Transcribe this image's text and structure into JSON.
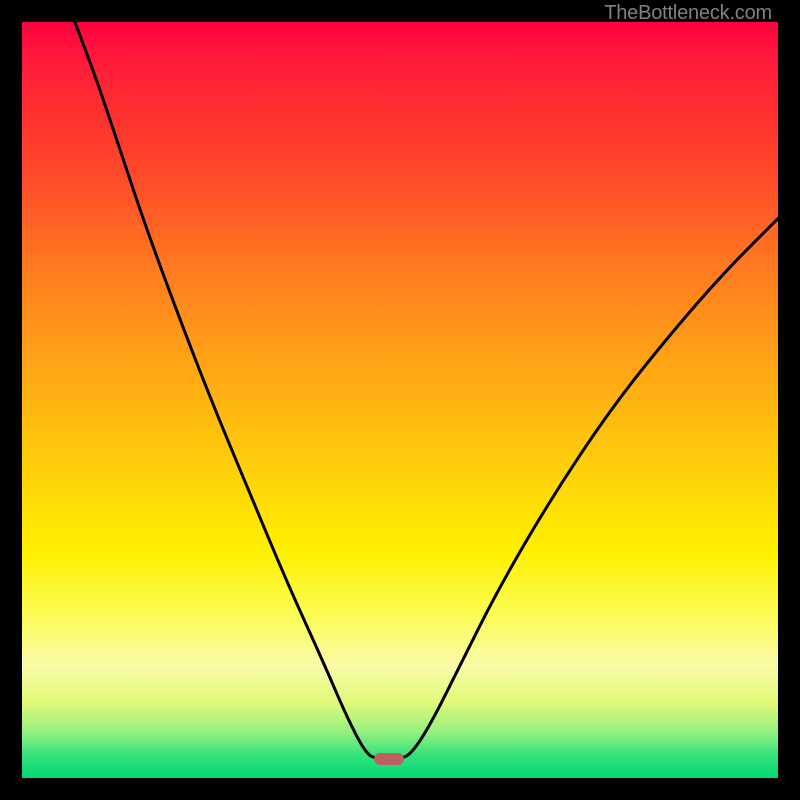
{
  "watermark": "TheBottleneck.com",
  "plot": {
    "inner_left": 22,
    "inner_top": 22,
    "inner_width": 756,
    "inner_height": 756
  },
  "chart_data": {
    "type": "line",
    "title": "",
    "xlabel": "",
    "ylabel": "",
    "xlim": [
      0,
      100
    ],
    "ylim": [
      0,
      100
    ],
    "marker": {
      "x_frac": 0.485,
      "y_frac": 0.975
    },
    "curve_points": [
      {
        "x_frac": 0.07,
        "y_frac": 0.0
      },
      {
        "x_frac": 0.1,
        "y_frac": 0.08
      },
      {
        "x_frac": 0.13,
        "y_frac": 0.17
      },
      {
        "x_frac": 0.16,
        "y_frac": 0.26
      },
      {
        "x_frac": 0.2,
        "y_frac": 0.37
      },
      {
        "x_frac": 0.25,
        "y_frac": 0.5
      },
      {
        "x_frac": 0.3,
        "y_frac": 0.62
      },
      {
        "x_frac": 0.35,
        "y_frac": 0.74
      },
      {
        "x_frac": 0.4,
        "y_frac": 0.85
      },
      {
        "x_frac": 0.43,
        "y_frac": 0.92
      },
      {
        "x_frac": 0.455,
        "y_frac": 0.968
      },
      {
        "x_frac": 0.47,
        "y_frac": 0.975
      },
      {
        "x_frac": 0.5,
        "y_frac": 0.975
      },
      {
        "x_frac": 0.515,
        "y_frac": 0.968
      },
      {
        "x_frac": 0.54,
        "y_frac": 0.93
      },
      {
        "x_frac": 0.58,
        "y_frac": 0.85
      },
      {
        "x_frac": 0.63,
        "y_frac": 0.75
      },
      {
        "x_frac": 0.7,
        "y_frac": 0.63
      },
      {
        "x_frac": 0.78,
        "y_frac": 0.51
      },
      {
        "x_frac": 0.86,
        "y_frac": 0.41
      },
      {
        "x_frac": 0.93,
        "y_frac": 0.33
      },
      {
        "x_frac": 1.0,
        "y_frac": 0.26
      }
    ]
  }
}
